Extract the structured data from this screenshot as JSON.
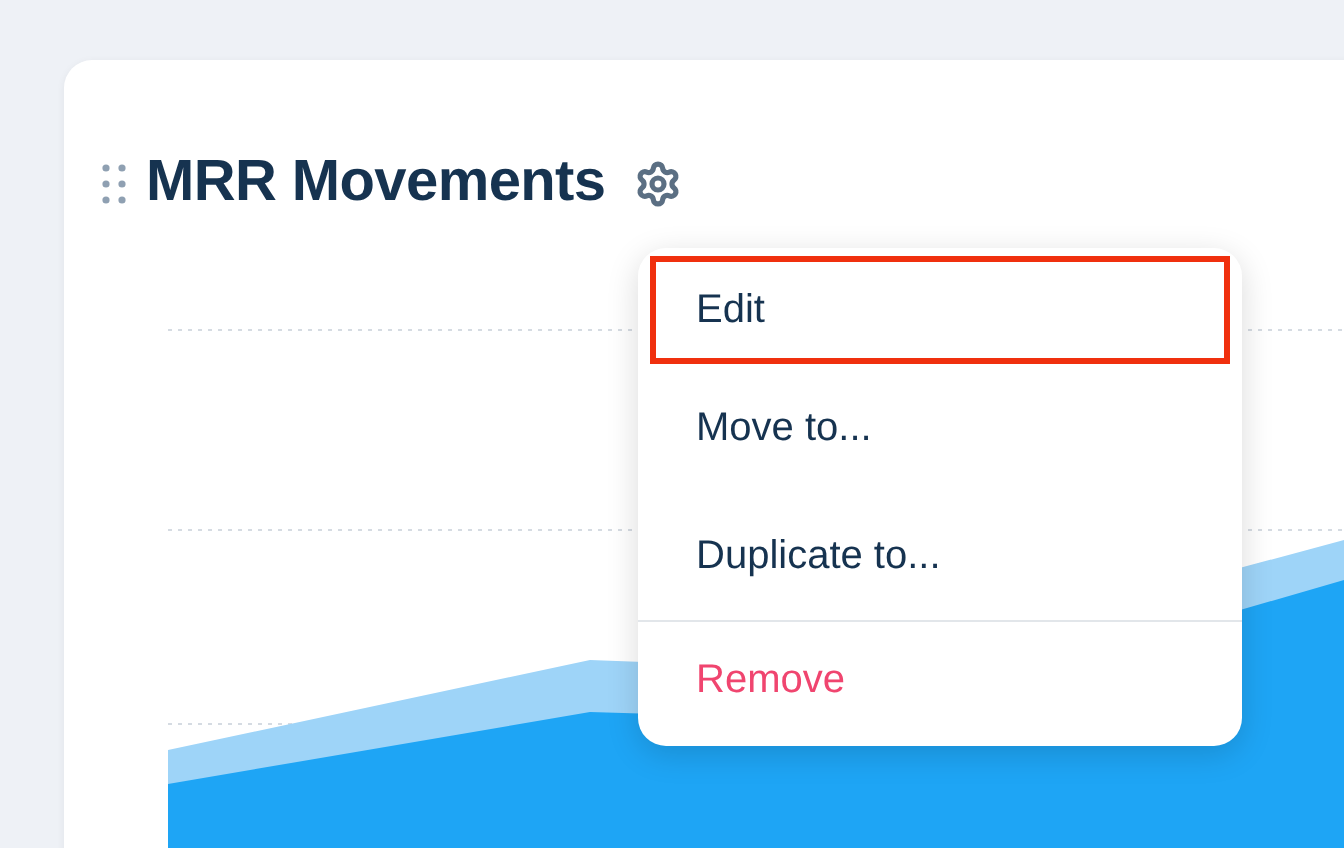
{
  "card": {
    "title": "MRR Movements"
  },
  "menu": {
    "items": [
      {
        "label": "Edit",
        "kind": "normal",
        "selected": true
      },
      {
        "label": "Move to...",
        "kind": "normal",
        "selected": false
      },
      {
        "label": "Duplicate to...",
        "kind": "normal",
        "selected": false
      },
      {
        "label": "Remove",
        "kind": "danger",
        "selected": false
      }
    ]
  }
}
